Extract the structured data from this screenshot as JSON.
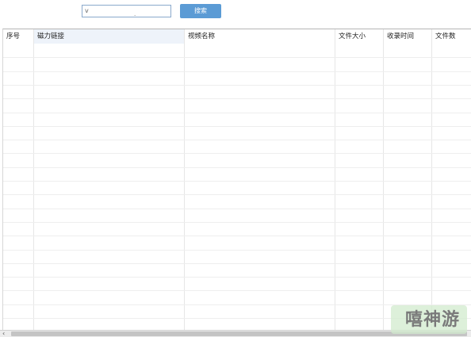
{
  "search": {
    "value": "v",
    "cursor_mark": ".",
    "button_label": "搜索"
  },
  "table": {
    "columns": [
      {
        "key": "index",
        "label": "序号"
      },
      {
        "key": "magnet",
        "label": "磁力链接"
      },
      {
        "key": "video_name",
        "label": "视频名称"
      },
      {
        "key": "file_size",
        "label": "文件大小"
      },
      {
        "key": "indexed_time",
        "label": "收录时间"
      },
      {
        "key": "file_count",
        "label": "文件数"
      }
    ],
    "rows": []
  },
  "scrollbar": {
    "left_arrow": "‹"
  },
  "watermark": {
    "text": "嘻神游"
  },
  "colors": {
    "button_bg": "#5b9bd5",
    "input_border": "#8aa9cc",
    "header_highlight": "#eef3fa",
    "watermark_bg": "#d2ebcd"
  }
}
